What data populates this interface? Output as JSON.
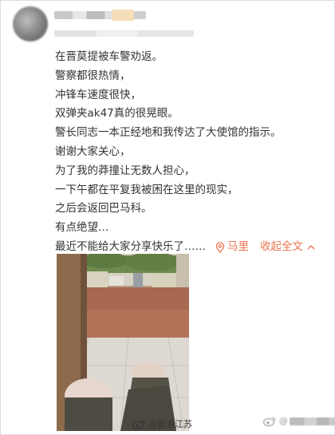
{
  "post": {
    "lines": [
      "在晋莫提被车警劝返。",
      "警察都很热情，",
      "冲锋车速度很快，",
      "双弹夹ak47真的很晃眼。",
      "警长同志一本正经地和我传达了大使馆的指示。",
      "谢谢大家关心，",
      "为了我的莽撞让无数人担心，",
      "一下午都在平复我被困在这里的现实，",
      "之后会返回巴马科。",
      "有点绝望…"
    ],
    "last_line": "最近不能给大家分享快乐了……",
    "location": "马里",
    "collapse_label": "收起全文",
    "location_icon": "location-pin-icon",
    "collapse_icon": "chevron-up-icon"
  },
  "watermark": {
    "source": "@新浪江苏",
    "blurred": "@"
  },
  "colors": {
    "link": "#eb7350",
    "text": "#333333"
  }
}
